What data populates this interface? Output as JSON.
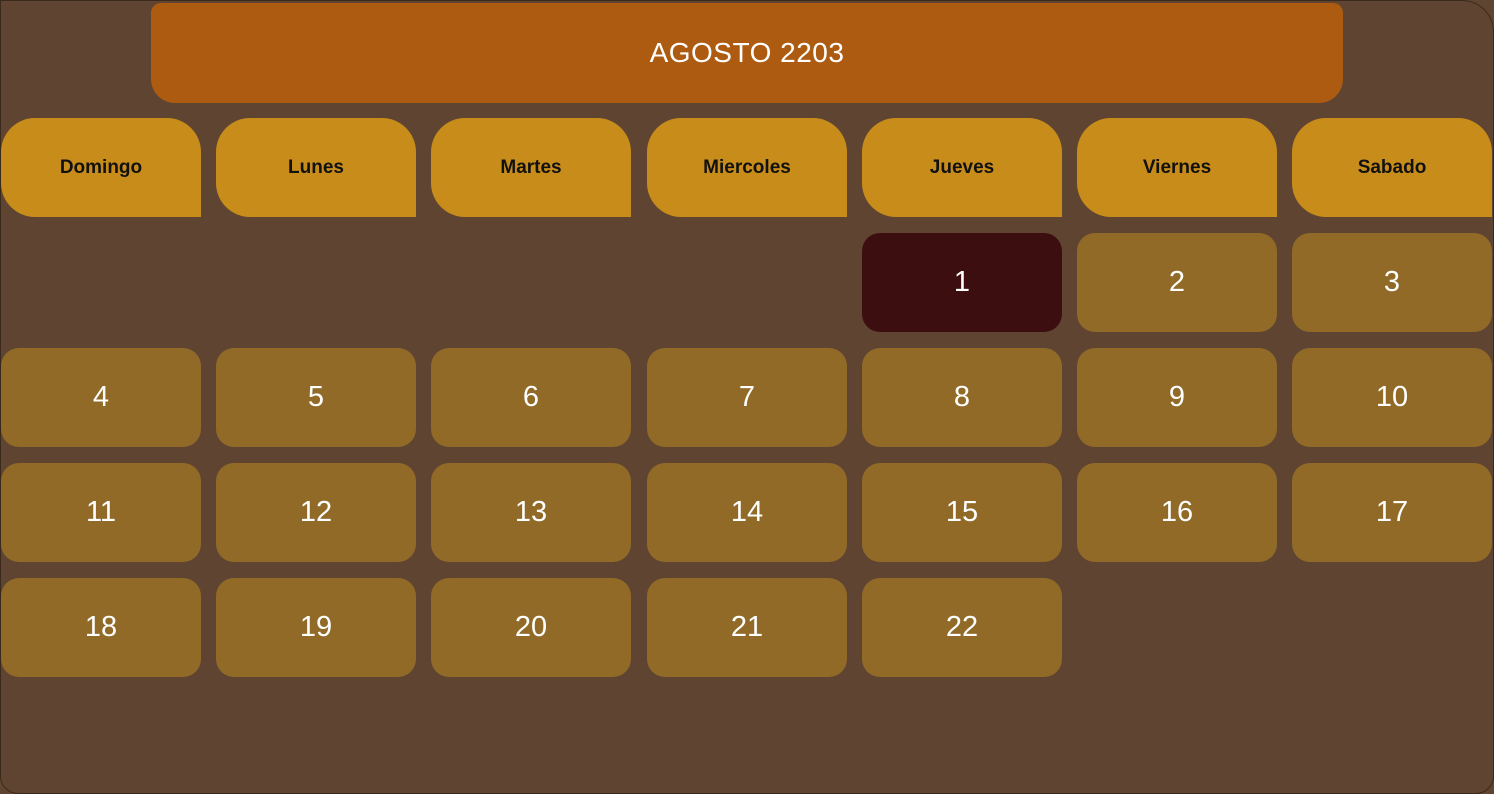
{
  "calendar": {
    "title": "AGOSTO 2203",
    "weekdays": [
      "Domingo",
      "Lunes",
      "Martes",
      "Miercoles",
      "Jueves",
      "Viernes",
      "Sabado"
    ],
    "days": [
      "1",
      "2",
      "3",
      "4",
      "5",
      "6",
      "7",
      "8",
      "9",
      "10",
      "11",
      "12",
      "13",
      "14",
      "15",
      "16",
      "17",
      "18",
      "19",
      "20",
      "21",
      "22"
    ],
    "today": "1"
  },
  "colors": {
    "background": "#5f4531",
    "header": "#ad5b10",
    "weekday": "#c88c1a",
    "day_cell": "#916a28",
    "today_cell": "#3d0e0f"
  }
}
